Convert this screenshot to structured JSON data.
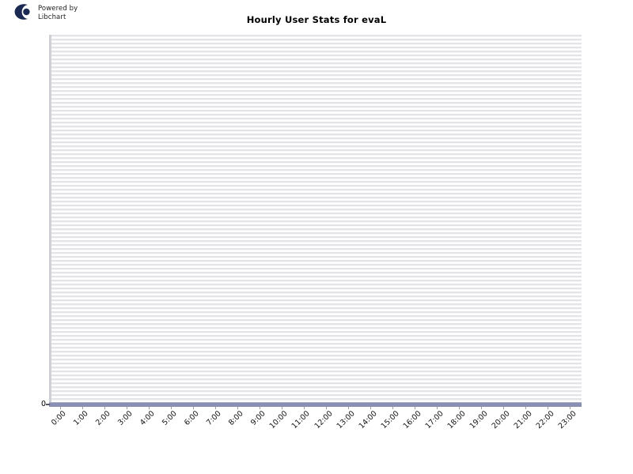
{
  "branding": {
    "logo_icon": "libchart-c-logo-icon",
    "line1": "Powered by",
    "line2": "Libchart"
  },
  "chart_data": {
    "type": "bar",
    "title": "Hourly User Stats for evaL",
    "xlabel": "",
    "ylabel": "",
    "categories": [
      "0:00",
      "1:00",
      "2:00",
      "3:00",
      "4:00",
      "5:00",
      "6:00",
      "7:00",
      "8:00",
      "9:00",
      "10:00",
      "11:00",
      "12:00",
      "13:00",
      "14:00",
      "15:00",
      "16:00",
      "17:00",
      "18:00",
      "19:00",
      "20:00",
      "21:00",
      "22:00",
      "23:00"
    ],
    "values": [
      0,
      0,
      0,
      0,
      0,
      0,
      0,
      0,
      0,
      0,
      0,
      0,
      0,
      0,
      0,
      0,
      0,
      0,
      0,
      0,
      0,
      0,
      0,
      0
    ],
    "y_tick_labels": [
      "0"
    ],
    "ylim": [
      0,
      0
    ],
    "grid": true,
    "grid_orientation": "horizontal",
    "legend": null,
    "bar_color": "#8b8fb4",
    "grid_color": "#e4e4e8",
    "plot_background": "#ffffff",
    "page_background": "#ffffff"
  }
}
